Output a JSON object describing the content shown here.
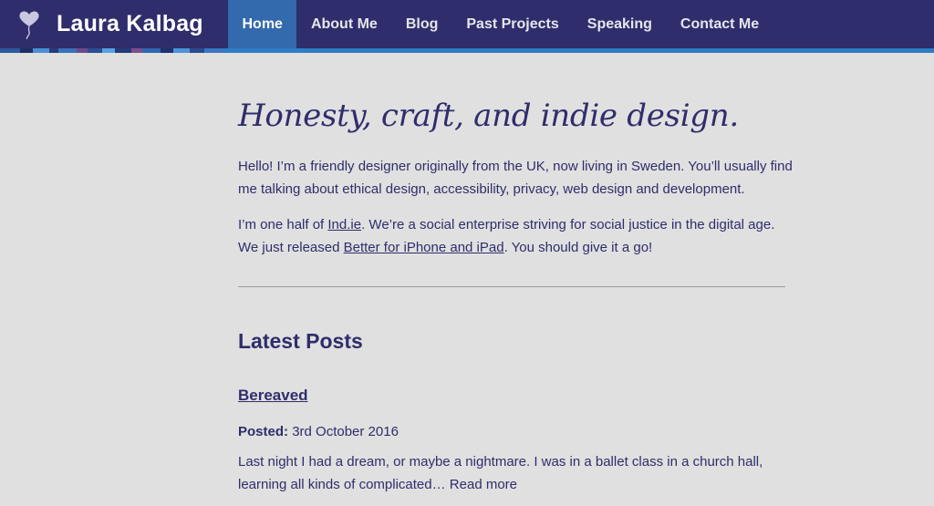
{
  "site": {
    "title": "Laura Kalbag"
  },
  "nav": {
    "items": [
      {
        "label": "Home",
        "active": true
      },
      {
        "label": "About Me",
        "active": false
      },
      {
        "label": "Blog",
        "active": false
      },
      {
        "label": "Past Projects",
        "active": false
      },
      {
        "label": "Speaking",
        "active": false
      },
      {
        "label": "Contact Me",
        "active": false
      }
    ]
  },
  "intro": {
    "headline": "Honesty, craft, and indie design.",
    "para1": "Hello! I’m a friendly designer originally from the UK, now living in Sweden. You’ll usually find me talking about ethical design, accessibility, privacy, web design and development.",
    "para2_prefix": "I’m one half of ",
    "para2_link1": "Ind.ie",
    "para2_middle": ". We’re a social enterprise striving for social justice in the digital age. We just released ",
    "para2_link2": "Better for iPhone and iPad",
    "para2_suffix": ". You should give it a go!"
  },
  "latest": {
    "section_title": "Latest Posts",
    "posts": [
      {
        "title": "Bereaved",
        "posted_label": "Posted:",
        "date": "3rd October 2016",
        "excerpt": "Last night I had a dream, or maybe a nightmare. I was in a ballet class in a church hall, learning all kinds of complicated… ",
        "read_more": "Read more"
      }
    ]
  },
  "colors": {
    "header_bg": "#2f2d6b",
    "active_nav_bg": "#3369ad",
    "stripe": "#2f7cc5",
    "page_bg": "#e0e0e0",
    "text": "#2f2d6b"
  },
  "icons": {
    "logo": "heart-balloon-icon"
  }
}
